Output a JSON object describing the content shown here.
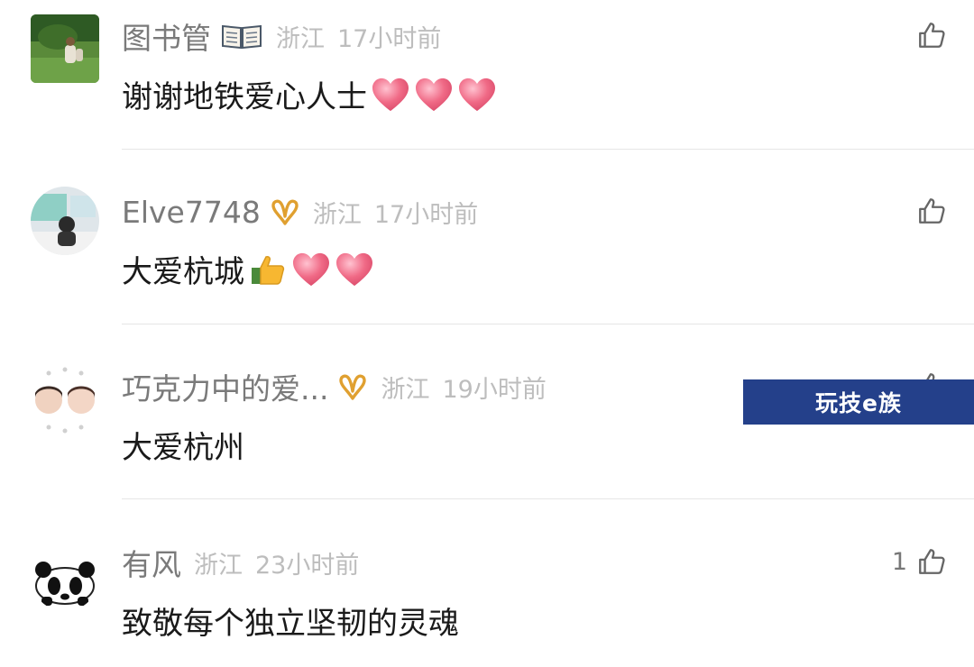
{
  "comments": [
    {
      "username": "图书管",
      "location": "浙江",
      "time": "17小时前",
      "text": "谢谢地铁爱心人士",
      "likes": ""
    },
    {
      "username": "Elve7748",
      "location": "浙江",
      "time": "17小时前",
      "text": "大爱杭城",
      "likes": ""
    },
    {
      "username": "巧克力中的爱...",
      "location": "浙江",
      "time": "19小时前",
      "text": "大爱杭州",
      "likes": ""
    },
    {
      "username": "有风",
      "location": "浙江",
      "time": "23小时前",
      "text": "致敬每个独立坚韧的灵魂",
      "likes": "1"
    }
  ],
  "watermark": "玩技e族",
  "icons": {
    "like": "thumbs-up-icon",
    "book_badge": "open-book-icon",
    "vip_badge": "gold-ribbon-badge-icon",
    "heart_emoji": "heart-emoji",
    "thumbs_up_emoji": "thumbs-up-emoji"
  },
  "colors": {
    "username": "#7a7a7a",
    "meta": "#bdbdbd",
    "text": "#1a1a1a",
    "badge_gold": "#e0a030",
    "heart": "#f06a86",
    "watermark_bg": "#24408a"
  }
}
